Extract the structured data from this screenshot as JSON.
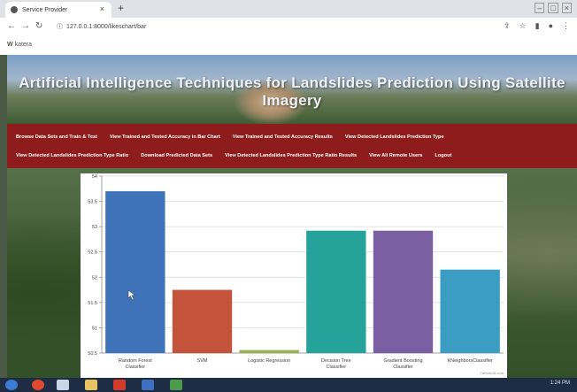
{
  "browser": {
    "tab_title": "Service Provider",
    "tab_close": "×",
    "new_tab": "+",
    "url": "127.0.0.1:8000/likeschart/bar",
    "bookmark": "katera",
    "win_min": "–",
    "win_max": "□",
    "win_close": "×"
  },
  "page": {
    "title": "Artificial Intelligence Techniques for Landslides Prediction Using Satellite Imagery",
    "menu": [
      "Browse Data Sets and Train & Test",
      "View Trained and Tested Accuracy in Bar Chart",
      "View Trained and Tested Accuracy Results",
      "View Detected Landslides Prediction Type",
      "View Detected Landslides Prediction Type Ratio",
      "Download Predicted Data Sets",
      "View Detected Landslides Prediction Type Ratio Results",
      "View All Remote Users",
      "Logout"
    ]
  },
  "chart_data": {
    "type": "bar",
    "categories": [
      "Random Forest Classifier",
      "SVM",
      "Logistic Regression",
      "Decision Tree Classifier",
      "Gradient Boosting Classifier",
      "KNeighborsClassifier"
    ],
    "values": [
      53.7,
      51.75,
      50.56,
      52.92,
      52.92,
      52.15
    ],
    "ylim": [
      50.5,
      54
    ],
    "yticks": [
      "50.5",
      "51",
      "51.5",
      "52",
      "52.5",
      "53",
      "53.5",
      "54"
    ],
    "colors": [
      "#3e73b9",
      "#c4533b",
      "#9bb04e",
      "#25a39a",
      "#7a5fa3",
      "#3b9dc1"
    ],
    "grid": true,
    "credit": "CanvasJS.com"
  },
  "taskbar": {
    "clock": "1:24 PM"
  }
}
